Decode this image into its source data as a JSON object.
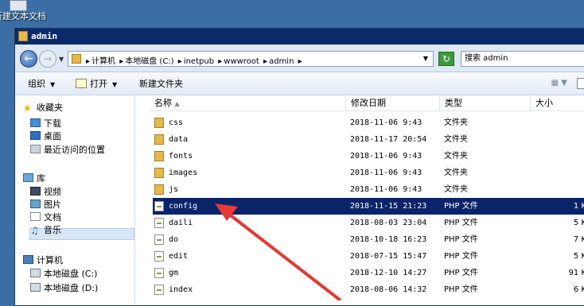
{
  "desktop": {
    "icon_label": "新建文本文档"
  },
  "window": {
    "title": "admin"
  },
  "address": {
    "crumbs": [
      "计算机",
      "本地磁盘 (C:)",
      "inetpub",
      "wwwroot",
      "admin"
    ],
    "search_placeholder": "搜索 admin"
  },
  "toolbar": {
    "organize": "组织",
    "open": "打开",
    "new_folder": "新建文件夹"
  },
  "nav": {
    "favorites": "收藏夹",
    "downloads": "下载",
    "desktop": "桌面",
    "recent": "最近访问的位置",
    "libraries": "库",
    "videos": "视频",
    "pictures": "图片",
    "documents": "文档",
    "music": "音乐",
    "computer": "计算机",
    "disk_c": "本地磁盘 (C:)",
    "disk_d": "本地磁盘 (D:)"
  },
  "columns": {
    "name": "名称",
    "date": "修改日期",
    "type": "类型",
    "size": "大小"
  },
  "files": [
    {
      "name": "css",
      "date": "2018-11-06 9:43",
      "type": "文件夹",
      "size": "",
      "kind": "folder"
    },
    {
      "name": "data",
      "date": "2018-11-17 20:54",
      "type": "文件夹",
      "size": "",
      "kind": "folder"
    },
    {
      "name": "fonts",
      "date": "2018-11-06 9:43",
      "type": "文件夹",
      "size": "",
      "kind": "folder"
    },
    {
      "name": "images",
      "date": "2018-11-06 9:43",
      "type": "文件夹",
      "size": "",
      "kind": "folder"
    },
    {
      "name": "js",
      "date": "2018-11-06 9:43",
      "type": "文件夹",
      "size": "",
      "kind": "folder"
    },
    {
      "name": "config",
      "date": "2018-11-15 21:23",
      "type": "PHP 文件",
      "size": "1 K",
      "kind": "php",
      "selected": true
    },
    {
      "name": "daili",
      "date": "2018-08-03 23:04",
      "type": "PHP 文件",
      "size": "5 K",
      "kind": "php"
    },
    {
      "name": "do",
      "date": "2018-10-18 16:23",
      "type": "PHP 文件",
      "size": "7 K",
      "kind": "php"
    },
    {
      "name": "edit",
      "date": "2018-07-15 15:47",
      "type": "PHP 文件",
      "size": "5 K",
      "kind": "php"
    },
    {
      "name": "gm",
      "date": "2018-12-10 14:27",
      "type": "PHP 文件",
      "size": "91 K",
      "kind": "php"
    },
    {
      "name": "index",
      "date": "2018-08-06 14:32",
      "type": "PHP 文件",
      "size": "6 K",
      "kind": "php"
    }
  ],
  "colors": {
    "titlebar": "#0b2a6a",
    "selected_row": "#0a246a",
    "annotation_arrow": "#e53935"
  }
}
